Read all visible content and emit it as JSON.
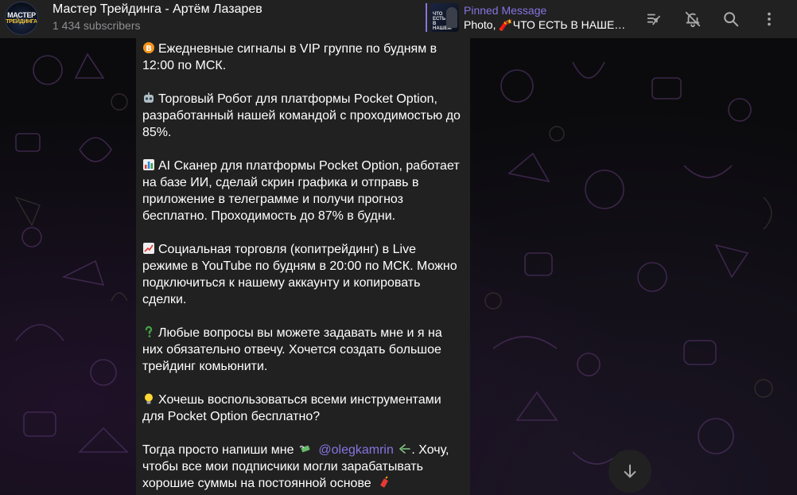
{
  "header": {
    "avatar_line1": "МАСТЕР",
    "avatar_line2": "ТРЕЙДИНГА",
    "channel_title": "Мастер Трейдинга - Артём Лазарев",
    "subscribers": "1 434 subscribers",
    "pinned_label": "Pinned Message",
    "pinned_preview": "Photo, 🧨ЧТО ЕСТЬ В НАШЕ…",
    "pinned_thumb_text": "ЧТО ЕСТЬ В НАШЕМ",
    "icons": [
      "pin-list-icon",
      "bell-off-icon",
      "search-icon",
      "more-vertical-icon"
    ]
  },
  "message": {
    "paragraphs": [
      {
        "emoji": "bitcoin-icon",
        "text": "Ежедневные сигналы в VIP группе по будням в 12:00 по МСК."
      },
      {
        "emoji": "robot-icon",
        "text": "Торговый Робот для платформы Pocket Option, разработанный нашей командой с проходимостью до 85%."
      },
      {
        "emoji": "bar-chart-icon",
        "text": "AI Сканер для платформы Pocket Option, работает на базе ИИ, сделай скрин графика и отправь в приложение в телеграмме и получи прогноз бесплатно. Проходимость до 87% в будни."
      },
      {
        "emoji": "chart-increasing-icon",
        "text": "Социальная торговля (копитрейдинг) в Live режиме в YouTube по будням в 20:00 по МСК. Можно подключиться к нашему аккаунту и копировать сделки."
      },
      {
        "emoji": "question-icon",
        "text": "Любые вопросы вы можете задавать мне и я на них обязательно отвечу. Хочется создать большое трейдинг комьюнити."
      },
      {
        "emoji": "lightbulb-icon",
        "text": "Хочешь воспользоваться всеми инструментами для Pocket Option бесплатно?"
      }
    ],
    "last": {
      "before": "Тогда просто напиши мне",
      "mention": "@olegkamrin",
      "after": ". Хочу, чтобы все мои подписчики могли зарабатывать хорошие суммы на постоянной основе"
    }
  },
  "colors": {
    "accent": "#8774e1",
    "header_bg": "#212121",
    "bubble_bg": "#212121"
  }
}
